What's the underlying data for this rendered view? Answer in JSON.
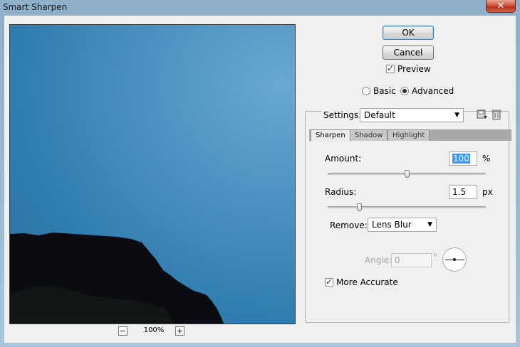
{
  "window": {
    "title": "Smart Sharpen",
    "close_glyph": "✕"
  },
  "preview": {
    "zoom_level": "100%",
    "zoom_out": "−",
    "zoom_in": "+"
  },
  "buttons": {
    "ok": "OK",
    "cancel": "Cancel"
  },
  "preview_checkbox": {
    "label": "Preview",
    "checked": true
  },
  "mode": {
    "options": [
      "Basic",
      "Advanced"
    ],
    "selected": "Advanced"
  },
  "settings": {
    "label": "Settings:",
    "value": "Default",
    "save_icon": "save-settings-icon",
    "delete_icon": "trash-icon"
  },
  "tabs": [
    "Sharpen",
    "Shadow",
    "Highlight"
  ],
  "sharpen": {
    "amount_label": "Amount:",
    "amount_value": "100",
    "amount_unit": "%",
    "amount_level": 0.5,
    "radius_label": "Radius:",
    "radius_value": "1.5",
    "radius_unit": "px",
    "radius_level": 0.2,
    "remove_label": "Remove:",
    "remove_value": "Lens Blur",
    "angle_label": "Angle:",
    "angle_value": "0",
    "angle_unit": "°",
    "more_accurate_label": "More Accurate",
    "more_accurate_checked": true
  }
}
